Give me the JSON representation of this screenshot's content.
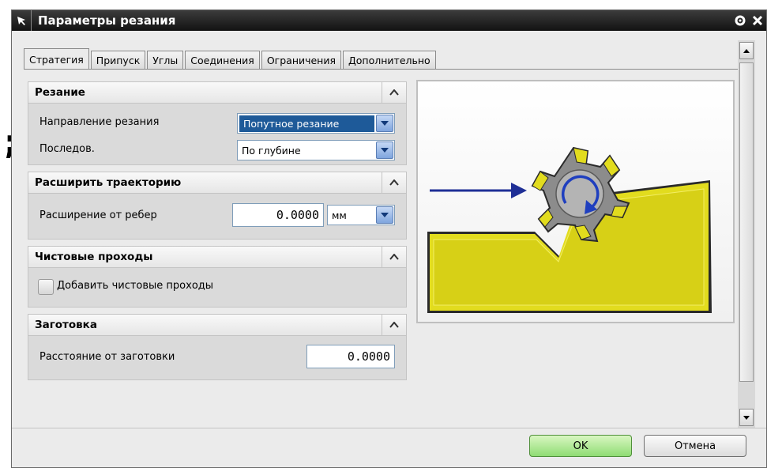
{
  "outside": {
    "fragment": ";"
  },
  "window": {
    "title": "Параметры резания"
  },
  "tabs": [
    {
      "label": "Стратегия",
      "active": true
    },
    {
      "label": "Припуск",
      "active": false
    },
    {
      "label": "Углы",
      "active": false
    },
    {
      "label": "Соединения",
      "active": false
    },
    {
      "label": "Ограничения",
      "active": false
    },
    {
      "label": "Дополнительно",
      "active": false
    }
  ],
  "groups": {
    "cutting": {
      "title": "Резание",
      "direction_label": "Направление резания",
      "direction_value": "Попутное резание",
      "order_label": "Последов.",
      "order_value": "По глубине"
    },
    "extend": {
      "title": "Расширить траекторию",
      "edge_label": "Расширение от ребер",
      "edge_value": "0.0000",
      "edge_unit": "мм"
    },
    "finish": {
      "title": "Чистовые проходы",
      "add_label": "Добавить чистовые проходы",
      "add_checked": false
    },
    "blank": {
      "title": "Заготовка",
      "distance_label": "Расстояние от заготовки",
      "distance_value": "0.0000"
    }
  },
  "buttons": {
    "ok": "OK",
    "cancel": "Отмена"
  },
  "colors": {
    "workpiece": "#e2dc1e",
    "arrow": "#1f2f96",
    "tool": "#8c8c8c",
    "ok_button": "#8fdc73",
    "titlebar": "#1e1e1e"
  }
}
